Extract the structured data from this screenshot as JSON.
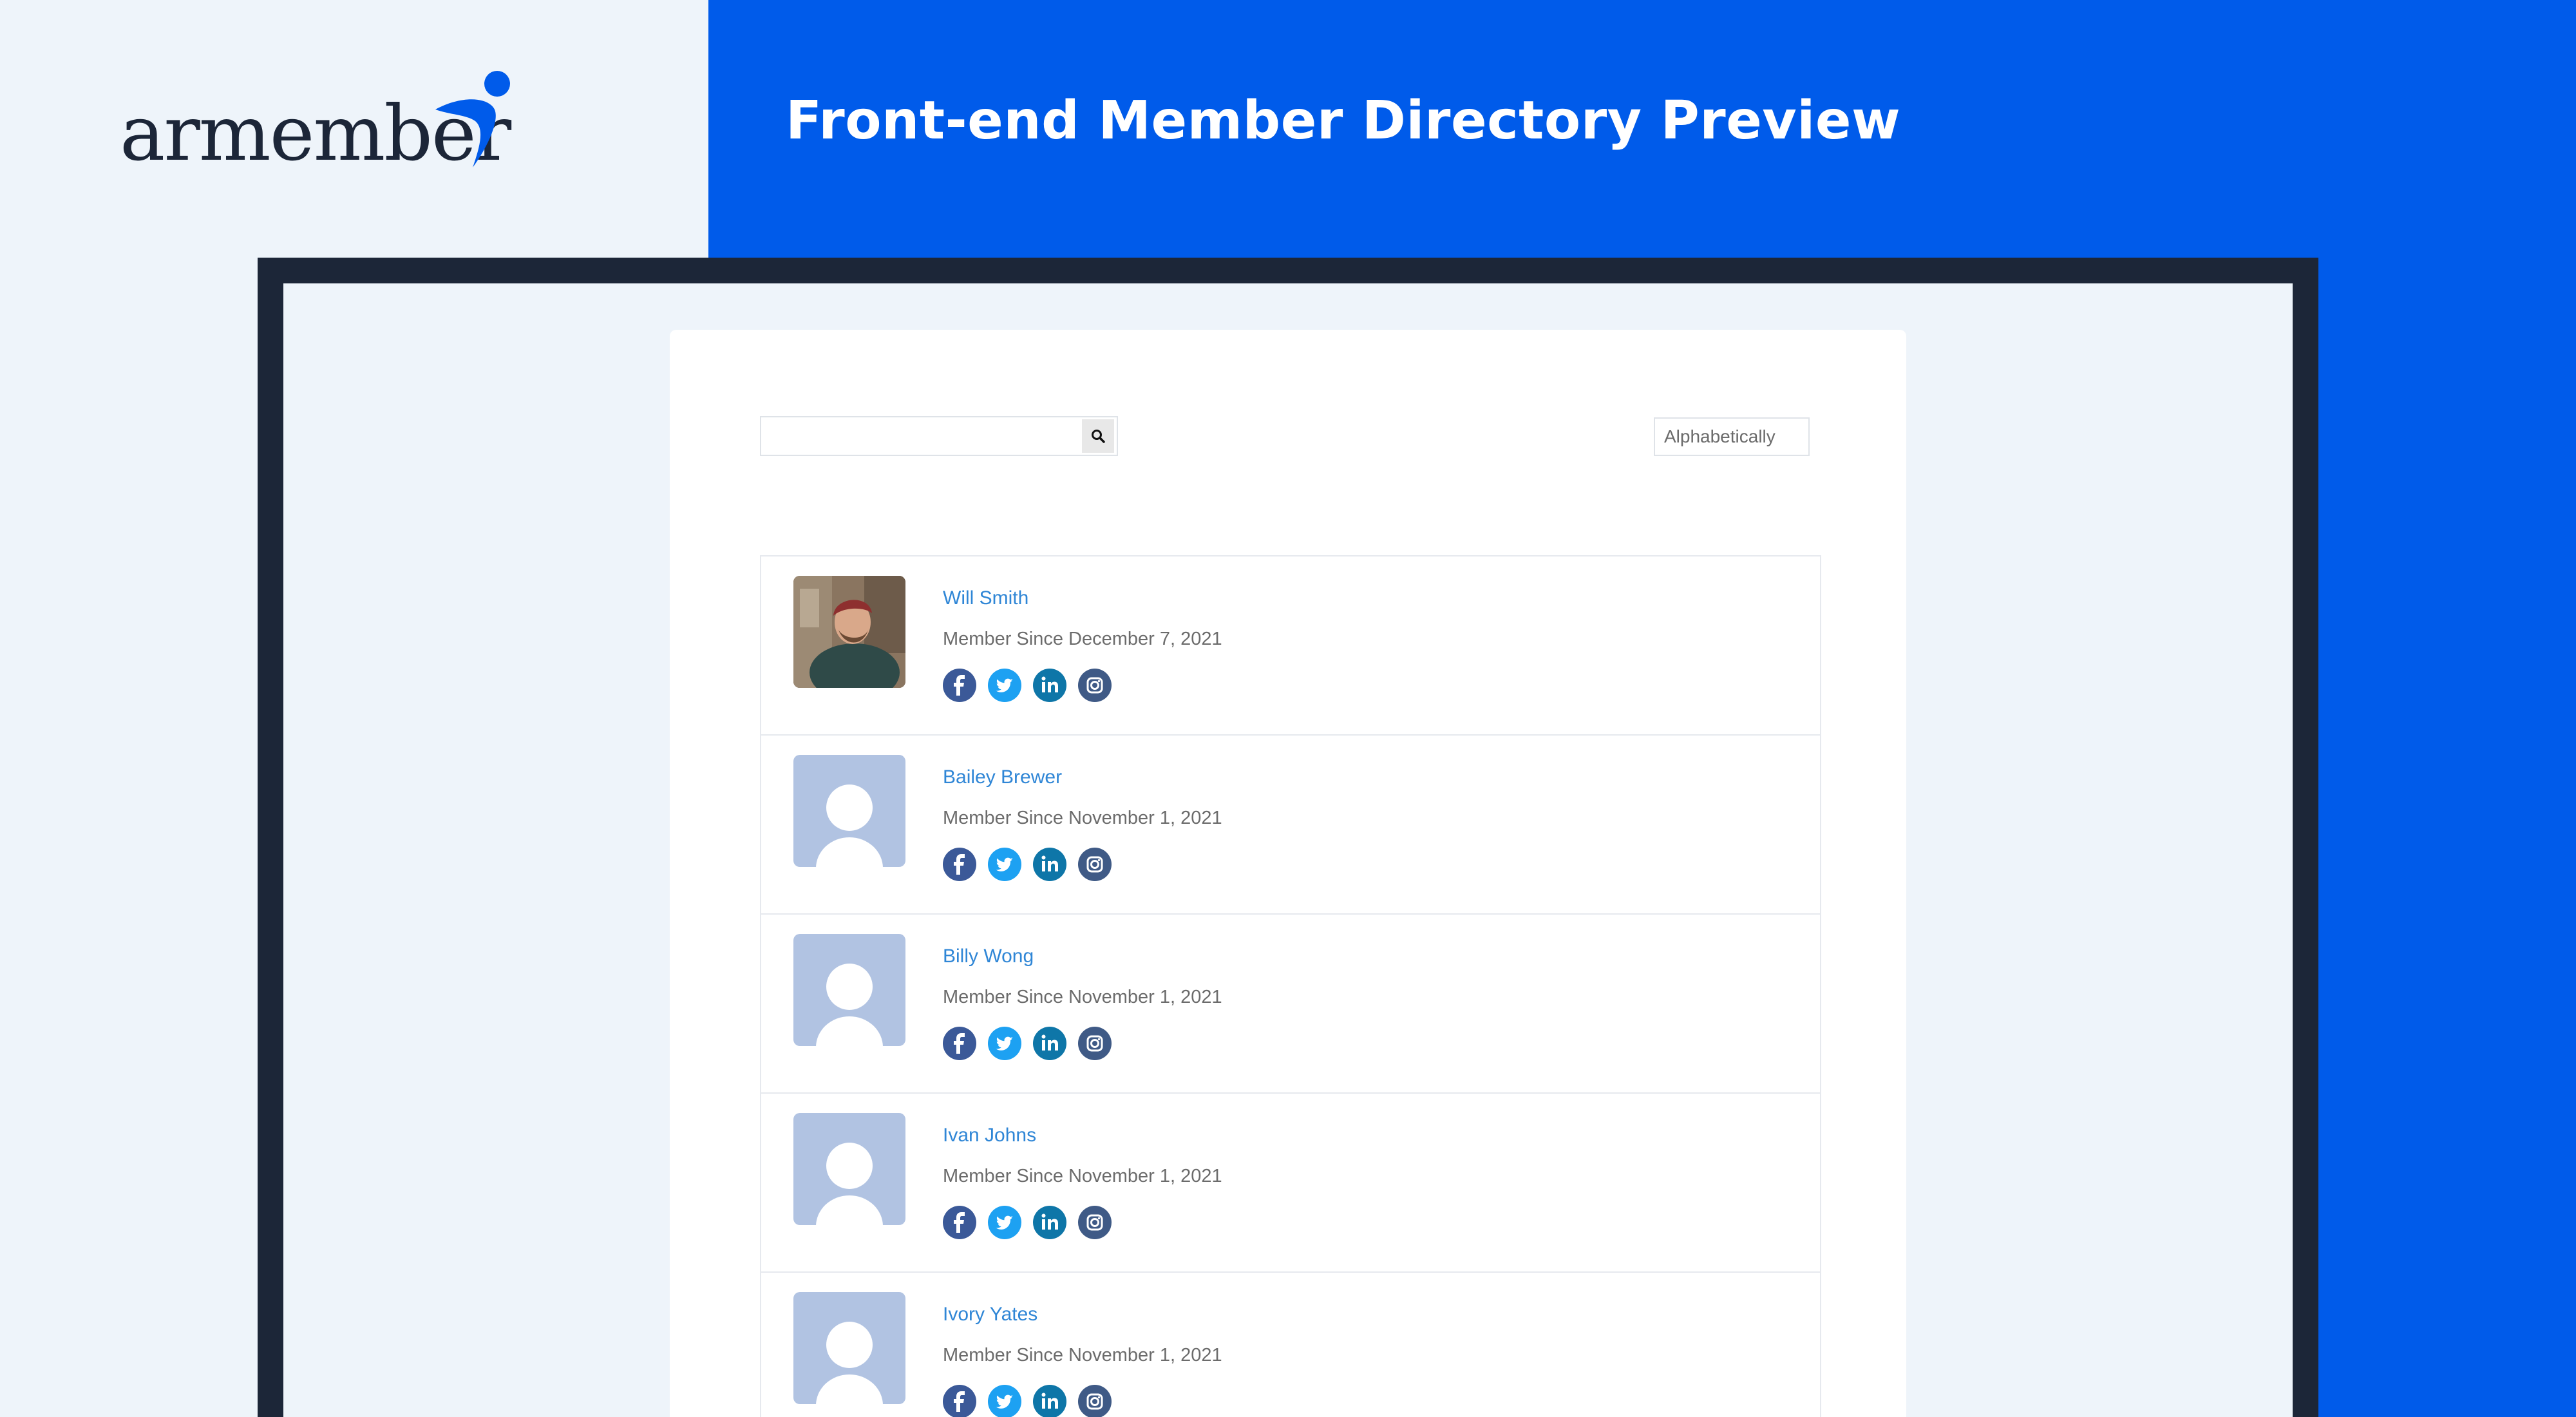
{
  "brand": {
    "logo_text": "armember",
    "accent": "#005bea",
    "dark": "#1c2638"
  },
  "header": {
    "title": "Front-end Member Directory Preview"
  },
  "directory": {
    "search": {
      "value": "",
      "placeholder": ""
    },
    "sort": {
      "selected": "Alphabetically"
    },
    "members": [
      {
        "name": "Will Smith",
        "since": "Member Since December 7, 2021",
        "avatar": "photo"
      },
      {
        "name": "Bailey Brewer",
        "since": "Member Since November 1, 2021",
        "avatar": "placeholder"
      },
      {
        "name": "Billy Wong",
        "since": "Member Since November 1, 2021",
        "avatar": "placeholder"
      },
      {
        "name": "Ivan Johns",
        "since": "Member Since November 1, 2021",
        "avatar": "placeholder"
      },
      {
        "name": "Ivory Yates",
        "since": "Member Since November 1, 2021",
        "avatar": "placeholder"
      }
    ],
    "social_icons": [
      "facebook-icon",
      "twitter-icon",
      "linkedin-icon",
      "instagram-icon"
    ],
    "social_colors": {
      "facebook": "#3b5998",
      "twitter": "#1da1f2",
      "linkedin": "#0e76a8",
      "instagram": "#3f5a86"
    }
  }
}
